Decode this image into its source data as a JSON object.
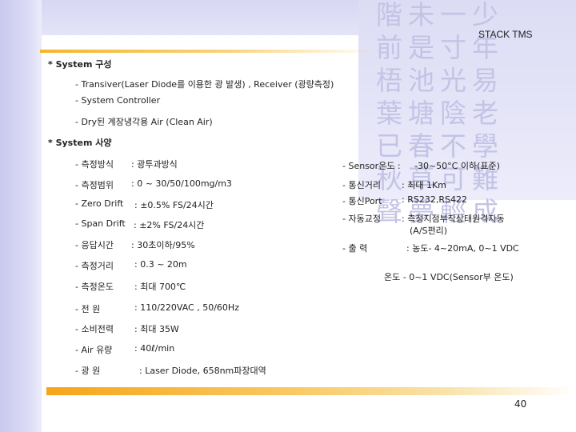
{
  "header": {
    "logo_text": "STACK TMS"
  },
  "background_chars": [
    "階未一少",
    "前是寸年",
    "梧池光易",
    "葉塘陰老",
    "已春不學",
    "秋草可難",
    "聲夢輕成"
  ],
  "system_config": {
    "heading": "* System 구성",
    "items": [
      "- Transiver(Laser Diode를 이용한 광 발생) , Receiver (광량측정)",
      "- System Controller",
      "- Dry된 계장냉각용 Air (Clean Air)"
    ]
  },
  "system_spec": {
    "heading": "* System 사양",
    "left": [
      {
        "label": "- 측정방식",
        "value": ": 광투과방식"
      },
      {
        "label": "- 측정범위",
        "value": ": 0 ~ 30/50/100mg/m3"
      },
      {
        "label": "- Zero Drift",
        "value": ": ±0.5% FS/24시간"
      },
      {
        "label": "- Span Drift",
        "value": ": ±2% FS/24시간"
      },
      {
        "label": "- 응답시간",
        "value": ": 30초이하/95%"
      },
      {
        "label": "- 측정거리",
        "value": ": 0.3 ~ 20m"
      },
      {
        "label": "- 측정온도",
        "value": ": 최대 700℃"
      },
      {
        "label": "- 전 원",
        "value": ": 110/220VAC , 50/60Hz"
      },
      {
        "label": "- 소비전력",
        "value": ": 최대 35W"
      },
      {
        "label": "- Air 유량",
        "value": ": 40ℓ/min"
      },
      {
        "label": "- 광 원",
        "value": ": Laser Diode, 658nm파장대역"
      }
    ],
    "right": [
      {
        "label": "- Sensor온도 :",
        "value": "-30~50°C 이하(표준)"
      },
      {
        "label": "- 통신거리",
        "value": ": 최대 1Km"
      },
      {
        "label": "- 통신Port",
        "value": ": RS232,RS422"
      },
      {
        "label": "- 자동교정",
        "value": ": 측정지점부착상태원격자동",
        "value2": "(A/S편리)"
      },
      {
        "label": "- 출 력",
        "value": ": 농도- 4~20mA, 0~1 VDC",
        "value2": "온도 - 0~1 VDC(Sensor부 온도)"
      }
    ]
  },
  "footer": {
    "page_number": "40"
  }
}
